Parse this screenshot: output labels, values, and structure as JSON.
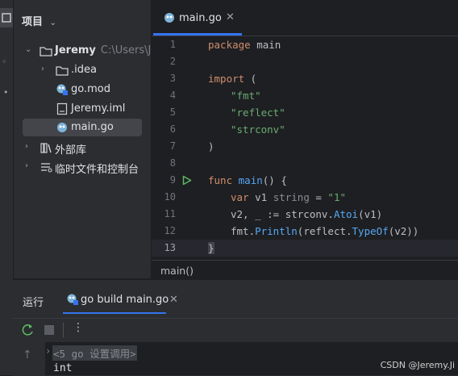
{
  "window": {
    "title": "项目"
  },
  "project_tree": {
    "root": {
      "name": "Jeremy",
      "path": "C:\\Users\\Jer"
    },
    "items": [
      {
        "label": ".idea",
        "kind": "folder"
      },
      {
        "label": "go.mod",
        "kind": "gomod"
      },
      {
        "label": "Jeremy.iml",
        "kind": "file"
      },
      {
        "label": "main.go",
        "kind": "gofile",
        "selected": true
      },
      {
        "label": "外部库",
        "kind": "library"
      },
      {
        "label": "临时文件和控制台",
        "kind": "scratches"
      }
    ]
  },
  "editor": {
    "tab": {
      "label": "main.go"
    },
    "line_numbers": [
      "1",
      "2",
      "3",
      "4",
      "5",
      "6",
      "7",
      "8",
      "9",
      "10",
      "11",
      "12",
      "13"
    ],
    "current_line": "13",
    "breadcrumb": "main()"
  },
  "code": {
    "l1_kw": "package",
    "l1_rest": " main",
    "l3_kw": "import",
    "l3_rest": " (",
    "l4": "\"fmt\"",
    "l5": "\"reflect\"",
    "l6": "\"strconv\"",
    "l7": ")",
    "l9_kw": "func",
    "l9_fn": "main",
    "l9_rest": "() {",
    "l10_kw": "var",
    "l10_a": " v1 ",
    "l10_typ": "string",
    "l10_b": " = ",
    "l10_str": "\"1\"",
    "l11_a": "v2, _ := ",
    "l11_pkg": "strconv",
    "l11_dot": ".",
    "l11_fn": "Atoi",
    "l11_b": "(v1)",
    "l12_pkg": "fmt",
    "l12_dot": ".",
    "l12_fn": "Println",
    "l12_b": "(reflect.",
    "l12_fn2": "TypeOf",
    "l12_c": "(v2))",
    "l13": "}"
  },
  "run_panel": {
    "title": "运行",
    "tab_label": "go build main.go",
    "console_cmd": "<5 go 设置调用>",
    "console_output": "int"
  },
  "watermark": "CSDN @Jeremy.Ji",
  "colors": {
    "accent": "#3574f0",
    "keyword": "#cf8e6d",
    "string": "#6aab73",
    "function": "#56a8f5",
    "run_green": "#5fb865"
  }
}
